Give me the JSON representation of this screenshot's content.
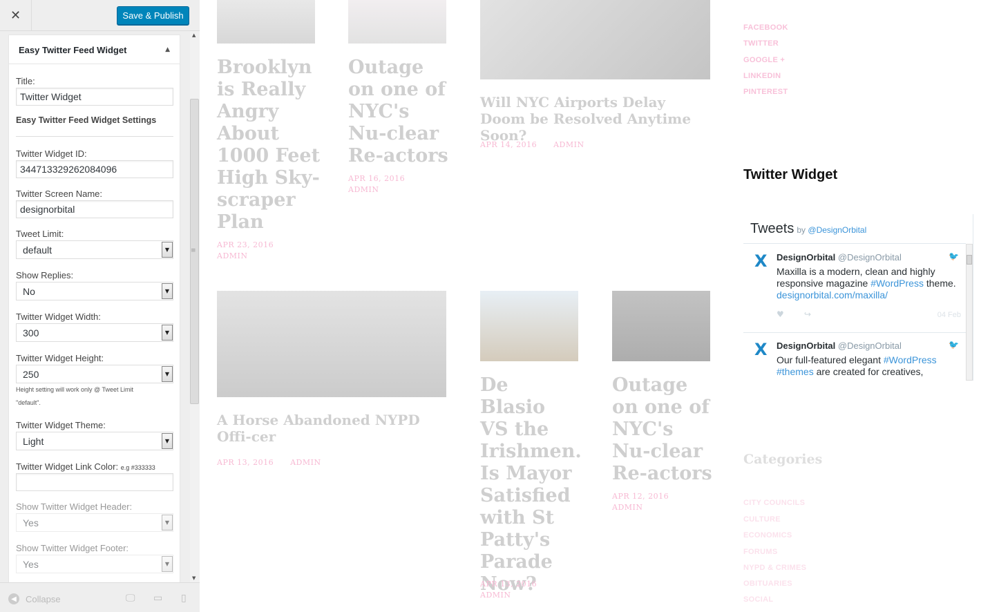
{
  "customizer": {
    "close_icon": "close-icon",
    "publish_label": "Save & Publish",
    "widget": {
      "title": "Easy Twitter Feed Widget",
      "fields": {
        "title_label": "Title:",
        "title_value": "Twitter Widget",
        "settings_heading": "Easy Twitter Feed Widget Settings",
        "widget_id_label": "Twitter Widget ID:",
        "widget_id_value": "344713329262084096",
        "screen_name_label": "Twitter Screen Name:",
        "screen_name_value": "designorbital",
        "tweet_limit_label": "Tweet Limit:",
        "tweet_limit_value": "default",
        "show_replies_label": "Show Replies:",
        "show_replies_value": "No",
        "width_label": "Twitter Widget Width:",
        "width_value": "300",
        "height_label": "Twitter Widget Height:",
        "height_value": "250",
        "height_note_1": "Height setting will work only @ Tweet Limit",
        "height_note_2": "\"default\".",
        "theme_label": "Twitter Widget Theme:",
        "theme_value": "Light",
        "link_color_label": "Twitter Widget Link Color:",
        "link_color_hint": "e.g #333333",
        "link_color_value": "",
        "show_header_label": "Show Twitter Widget Header:",
        "show_header_value": "Yes",
        "show_footer_label": "Show Twitter Widget Footer:",
        "show_footer_value": "Yes"
      }
    },
    "footer": {
      "collapse_label": "Collapse"
    }
  },
  "preview": {
    "posts": [
      {
        "title": "Brooklyn is Really Angry About 1000 Feet High Sky-scraper Plan",
        "date": "APR 23, 2016",
        "author": "ADMIN"
      },
      {
        "title": "Outage on one of NYC's Nu-clear Re-actors",
        "date": "APR 16, 2016",
        "author": "ADMIN"
      },
      {
        "title": "Will NYC Airports Delay Doom be Resolved Anytime Soon?",
        "date": "APR 14, 2016",
        "author": "ADMIN"
      },
      {
        "title": "A Horse Abandoned NYPD Offi-cer",
        "date": "APR 13, 2016",
        "author": "ADMIN"
      },
      {
        "title": "De Blasio VS the Irishmen. Is Mayor Satisfied with St Patty's Parade Now?",
        "date": "APR 13, 2016",
        "author": "ADMIN"
      },
      {
        "title": "Outage on one of NYC's Nu-clear Re-actors",
        "date": "APR 12, 2016",
        "author": "ADMIN"
      }
    ],
    "social": [
      "FACEBOOK",
      "TWITTER",
      "GOOGLE +",
      "LINKEDIN",
      "PINTEREST"
    ],
    "twitter_widget": {
      "heading": "Twitter Widget",
      "tweets_label": "Tweets",
      "by_label": "by",
      "by_handle": "@DesignOrbital",
      "tweets": [
        {
          "name": "DesignOrbital",
          "screen_name": "@DesignOrbital",
          "text_1": "Maxilla is a modern, clean and highly responsive magazine ",
          "hashtag_1": "#WordPress",
          "text_2": " theme.",
          "link": "designorbital.com/maxilla/",
          "date": "04 Feb"
        },
        {
          "name": "DesignOrbital",
          "screen_name": "@DesignOrbital",
          "text_1": "Our full-featured elegant ",
          "hashtag_1": "#WordPress",
          "text_2": " ",
          "hashtag_2": "#themes",
          "text_3": " are created for creatives,"
        }
      ]
    },
    "categories_heading": "Categories",
    "categories": [
      "CITY COUNCILS",
      "CULTURE",
      "ECONOMICS",
      "FORUMS",
      "NYPD & CRIMES",
      "OBITUARIES",
      "SOCIAL"
    ]
  }
}
